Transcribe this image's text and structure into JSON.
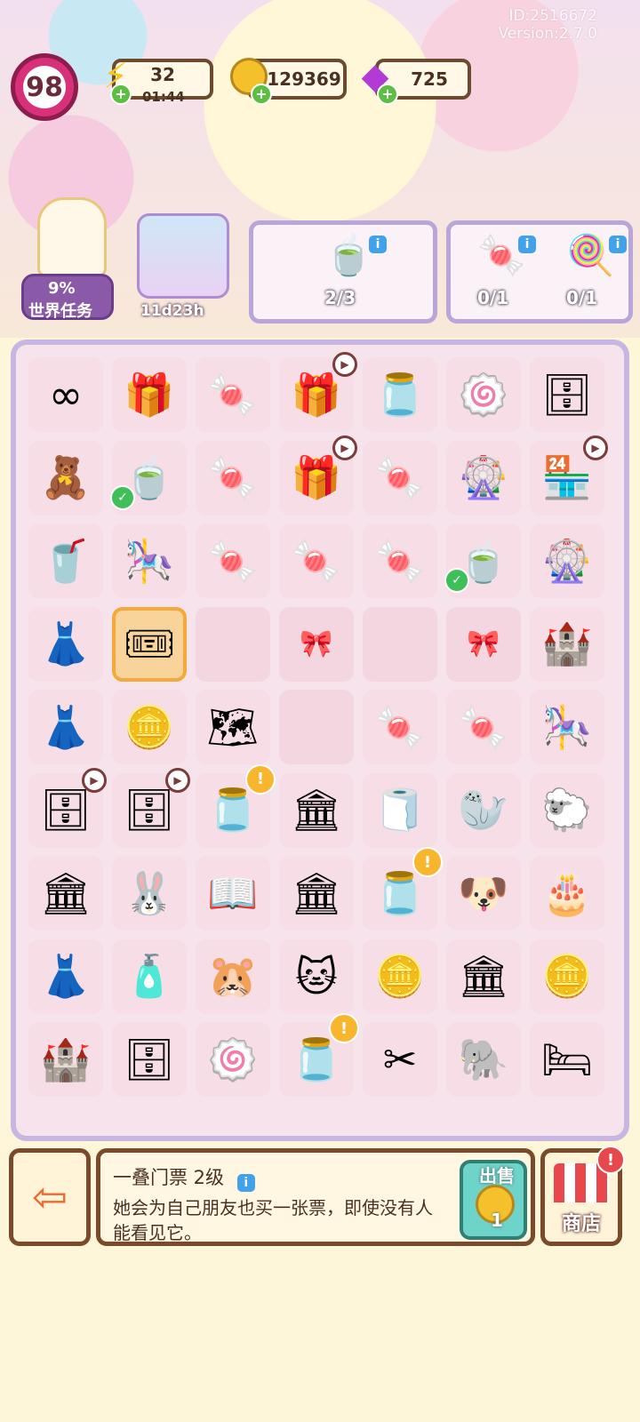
{
  "header": {
    "user_id": "ID:2516672",
    "version": "Version:2.7.0",
    "level": "98",
    "energy": {
      "value": "32",
      "timer": "01:44"
    },
    "coins": "129369",
    "gems": "725"
  },
  "world_task": {
    "progress": "9%",
    "label": "世界任务",
    "icon": "unicorn-character-icon"
  },
  "event": {
    "timer": "11d23h",
    "icon": "carnival-event-icon"
  },
  "orders": [
    {
      "icon": "matcha-drink-icon",
      "count": "2/3"
    },
    {
      "icon": "green-candy-icon",
      "count": "0/1"
    },
    {
      "icon": "green-lollipop-icon",
      "count": "0/1"
    }
  ],
  "board": {
    "rows": [
      [
        {
          "icon": "∞",
          "name": "infinity-token-icon"
        },
        {
          "icon": "🎁",
          "name": "ribbon-box-icon"
        },
        {
          "icon": "🍬",
          "name": "candy-tray-icon"
        },
        {
          "icon": "🎁",
          "name": "gift-box-icon",
          "badge": "time"
        },
        {
          "icon": "🫙",
          "name": "candy-jar-icon"
        },
        {
          "icon": "🍥",
          "name": "roll-cake-icon"
        },
        {
          "icon": "🗄",
          "name": "cabinet-icon"
        }
      ],
      [
        {
          "icon": "🧸",
          "name": "teddy-bear-icon"
        },
        {
          "icon": "🍵",
          "name": "matcha-drink-icon",
          "badge": "check"
        },
        {
          "icon": "🍬",
          "name": "candy-bag-icon"
        },
        {
          "icon": "🎁",
          "name": "gift-box-icon",
          "badge": "time"
        },
        {
          "icon": "🍬",
          "name": "candy-bag-icon"
        },
        {
          "icon": "🎡",
          "name": "swing-ride-icon"
        },
        {
          "icon": "🏪",
          "name": "shop-building-icon",
          "badge": "time"
        }
      ],
      [
        {
          "icon": "🥤",
          "name": "strawberry-drink-icon"
        },
        {
          "icon": "🎠",
          "name": "carousel-icon"
        },
        {
          "icon": "🍬",
          "name": "candy-bag-icon"
        },
        {
          "icon": "🍬",
          "name": "candy-plate-icon"
        },
        {
          "icon": "🍬",
          "name": "candy-bag-icon"
        },
        {
          "icon": "🍵",
          "name": "matcha-drink-icon",
          "badge": "check"
        },
        {
          "icon": "🎡",
          "name": "ferris-wheel-icon"
        }
      ],
      [
        {
          "icon": "👗",
          "name": "purple-dress-icon"
        },
        {
          "icon": "🎟",
          "name": "ticket-stack-icon",
          "selected": true
        },
        {
          "icon": "",
          "name": "empty-cell",
          "empty": true
        },
        {
          "icon": "🎀",
          "name": "locked-bow-cell",
          "empty": true
        },
        {
          "icon": "",
          "name": "empty-cell",
          "empty": true
        },
        {
          "icon": "🎀",
          "name": "locked-bow-cell",
          "empty": true
        },
        {
          "icon": "🏰",
          "name": "pink-castle-icon"
        }
      ],
      [
        {
          "icon": "👗",
          "name": "purple-skirt-icon"
        },
        {
          "icon": "🪙",
          "name": "gold-coin-icon"
        },
        {
          "icon": "🗺",
          "name": "map-icon"
        },
        {
          "icon": "",
          "name": "empty-cell",
          "empty": true
        },
        {
          "icon": "🍬",
          "name": "candy-bag-icon"
        },
        {
          "icon": "🍬",
          "name": "candy-bag-icon"
        },
        {
          "icon": "🎠",
          "name": "teacup-ride-icon"
        }
      ],
      [
        {
          "icon": "🗄",
          "name": "wardrobe-icon",
          "badge": "time"
        },
        {
          "icon": "🗄",
          "name": "wardrobe-icon",
          "badge": "time"
        },
        {
          "icon": "🫙",
          "name": "glass-jar-icon",
          "badge": "alert"
        },
        {
          "icon": "🏛",
          "name": "ticket-booth-icon"
        },
        {
          "icon": "🧻",
          "name": "lint-roller-icon"
        },
        {
          "icon": "🦭",
          "name": "seal-plush-icon"
        },
        {
          "icon": "🐑",
          "name": "sheep-plush-icon"
        }
      ],
      [
        {
          "icon": "🏛",
          "name": "ticket-booth-icon"
        },
        {
          "icon": "🐰",
          "name": "bunny-plush-icon"
        },
        {
          "icon": "📖",
          "name": "book-icon"
        },
        {
          "icon": "🏛",
          "name": "ticket-booth-icon"
        },
        {
          "icon": "🫙",
          "name": "blue-jar-icon",
          "badge": "alert"
        },
        {
          "icon": "🐶",
          "name": "puppy-plush-icon"
        },
        {
          "icon": "🎂",
          "name": "cake-box-icon"
        }
      ],
      [
        {
          "icon": "👗",
          "name": "lilac-dress-icon"
        },
        {
          "icon": "🧴",
          "name": "perfume-bottles-icon"
        },
        {
          "icon": "🐹",
          "name": "hamster-plush-icon"
        },
        {
          "icon": "🐱",
          "name": "cat-plush-icon"
        },
        {
          "icon": "🪙",
          "name": "coin-pile-icon"
        },
        {
          "icon": "🏛",
          "name": "ticket-booth-icon"
        },
        {
          "icon": "🪙",
          "name": "coin-stack-icon"
        }
      ],
      [
        {
          "icon": "🏰",
          "name": "pink-castle-icon"
        },
        {
          "icon": "🗄",
          "name": "nightstand-icon"
        },
        {
          "icon": "🍥",
          "name": "roll-cake-icon"
        },
        {
          "icon": "🫙",
          "name": "blue-jar-icon",
          "badge": "alert"
        },
        {
          "icon": "✂",
          "name": "paper-scissors-icon"
        },
        {
          "icon": "🐘",
          "name": "elephant-plush-icon"
        },
        {
          "icon": "🛏",
          "name": "pink-bed-icon"
        }
      ]
    ]
  },
  "selected_item": {
    "name": "一叠门票 2级",
    "description": "她会为自己朋友也买一张票，即使没有人能看见它。",
    "sell_label": "出售",
    "sell_price": "1"
  },
  "shop": {
    "label": "商店",
    "alert": "!"
  },
  "exit_icon": "exit-door-icon"
}
